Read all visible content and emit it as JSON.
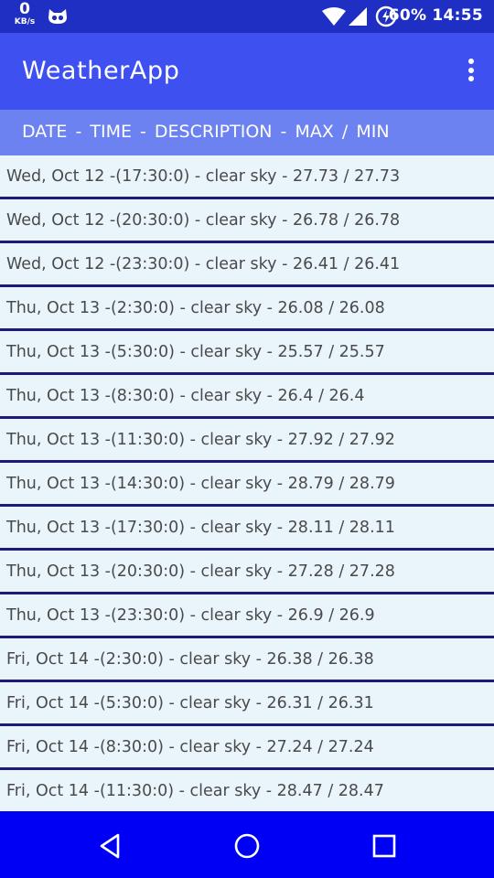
{
  "status_bar": {
    "net_speed_value": "0",
    "net_speed_unit": "KB/s",
    "battery_percent": "60%",
    "time": "14:55",
    "icons": [
      "cat-icon",
      "wifi-icon",
      "signal-icon",
      "battery-charging-icon"
    ]
  },
  "app_bar": {
    "title": "WeatherApp",
    "menu_icon": "more-vert-icon"
  },
  "list_header": {
    "label": "DATE -  TIME  -  DESCRIPTION  -  MAX / MIN"
  },
  "forecast": [
    "Wed, Oct 12 -(17:30:0) - clear sky - 27.73 / 27.73",
    "Wed, Oct 12 -(20:30:0) - clear sky - 26.78 / 26.78",
    "Wed, Oct 12 -(23:30:0) - clear sky - 26.41 / 26.41",
    "Thu, Oct 13 -(2:30:0) - clear sky - 26.08 / 26.08",
    "Thu, Oct 13 -(5:30:0) - clear sky - 25.57 / 25.57",
    "Thu, Oct 13 -(8:30:0) - clear sky - 26.4 / 26.4",
    "Thu, Oct 13 -(11:30:0) - clear sky - 27.92 / 27.92",
    "Thu, Oct 13 -(14:30:0) - clear sky - 28.79 / 28.79",
    "Thu, Oct 13 -(17:30:0) - clear sky - 28.11 / 28.11",
    "Thu, Oct 13 -(20:30:0) - clear sky - 27.28 / 27.28",
    "Thu, Oct 13 -(23:30:0) - clear sky - 26.9 / 26.9",
    "Fri, Oct 14 -(2:30:0) - clear sky - 26.38 / 26.38",
    "Fri, Oct 14 -(5:30:0) - clear sky - 26.31 / 26.31",
    "Fri, Oct 14 -(8:30:0) - clear sky - 27.24 / 27.24",
    "Fri, Oct 14 -(11:30:0) - clear sky - 28.47 / 28.47"
  ],
  "nav_bar": {
    "buttons": [
      "back-icon",
      "home-icon",
      "recents-icon"
    ]
  },
  "colors": {
    "status_bar": "#1f2fc4",
    "app_bar": "#3e50f0",
    "list_header": "#6c82f0",
    "row_background": "#eaf4fb",
    "row_divider": "#1c1a75",
    "nav_bar": "#0000f5"
  }
}
